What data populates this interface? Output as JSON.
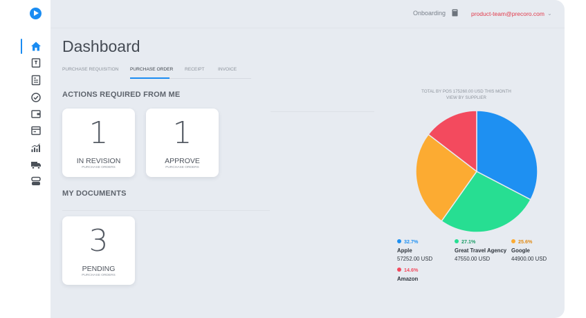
{
  "topbar": {
    "onboarding_label": "Onboarding",
    "user_email": "product-team@precoro.com"
  },
  "page": {
    "title": "Dashboard"
  },
  "tabs": [
    {
      "label": "Purchase Requisition",
      "active": false
    },
    {
      "label": "Purchase Order",
      "active": true
    },
    {
      "label": "Receipt",
      "active": false
    },
    {
      "label": "Invoice",
      "active": false
    }
  ],
  "actions": {
    "title": "ACTIONS REQUIRED FROM ME",
    "cards": [
      {
        "count": "1",
        "label": "IN REVISION",
        "sub": "Purchase orders"
      },
      {
        "count": "1",
        "label": "APPROVE",
        "sub": "Purchase orders"
      }
    ]
  },
  "documents": {
    "title": "MY DOCUMENTS",
    "cards": [
      {
        "count": "3",
        "label": "PENDING",
        "sub": "Purchase orders"
      }
    ]
  },
  "chart": {
    "title_line1": "Total by POs 175260.00 USD this month",
    "title_line2": "View by supplier"
  },
  "chart_data": {
    "type": "pie",
    "title": "Total by POs 175260.00 USD this month",
    "subtitle": "View by supplier",
    "categories": [
      "Apple",
      "Great Travel Agency",
      "Google",
      "Amazon"
    ],
    "percent_labels": [
      "32.7%",
      "27.1%",
      "25.6%",
      "14.6%"
    ],
    "values": [
      57252.0,
      47550.0,
      44900.0,
      25558.0
    ],
    "value_labels": [
      "57252.00 USD",
      "47550.00 USD",
      "44900.00 USD",
      ""
    ],
    "colors": [
      "#1e90f2",
      "#27de92",
      "#fcab32",
      "#f34a5e"
    ],
    "legend_position": "bottom"
  },
  "icons": {
    "sidebar": [
      "home-icon",
      "requisition-icon",
      "purchase-order-icon",
      "approval-icon",
      "wallet-icon",
      "invoice-icon",
      "analytics-icon",
      "delivery-truck-icon",
      "settings-toggle-icon"
    ]
  },
  "colors": {
    "accent": "#1a8cf2",
    "email": "#e23a4b",
    "background": "#e7ebf1"
  }
}
